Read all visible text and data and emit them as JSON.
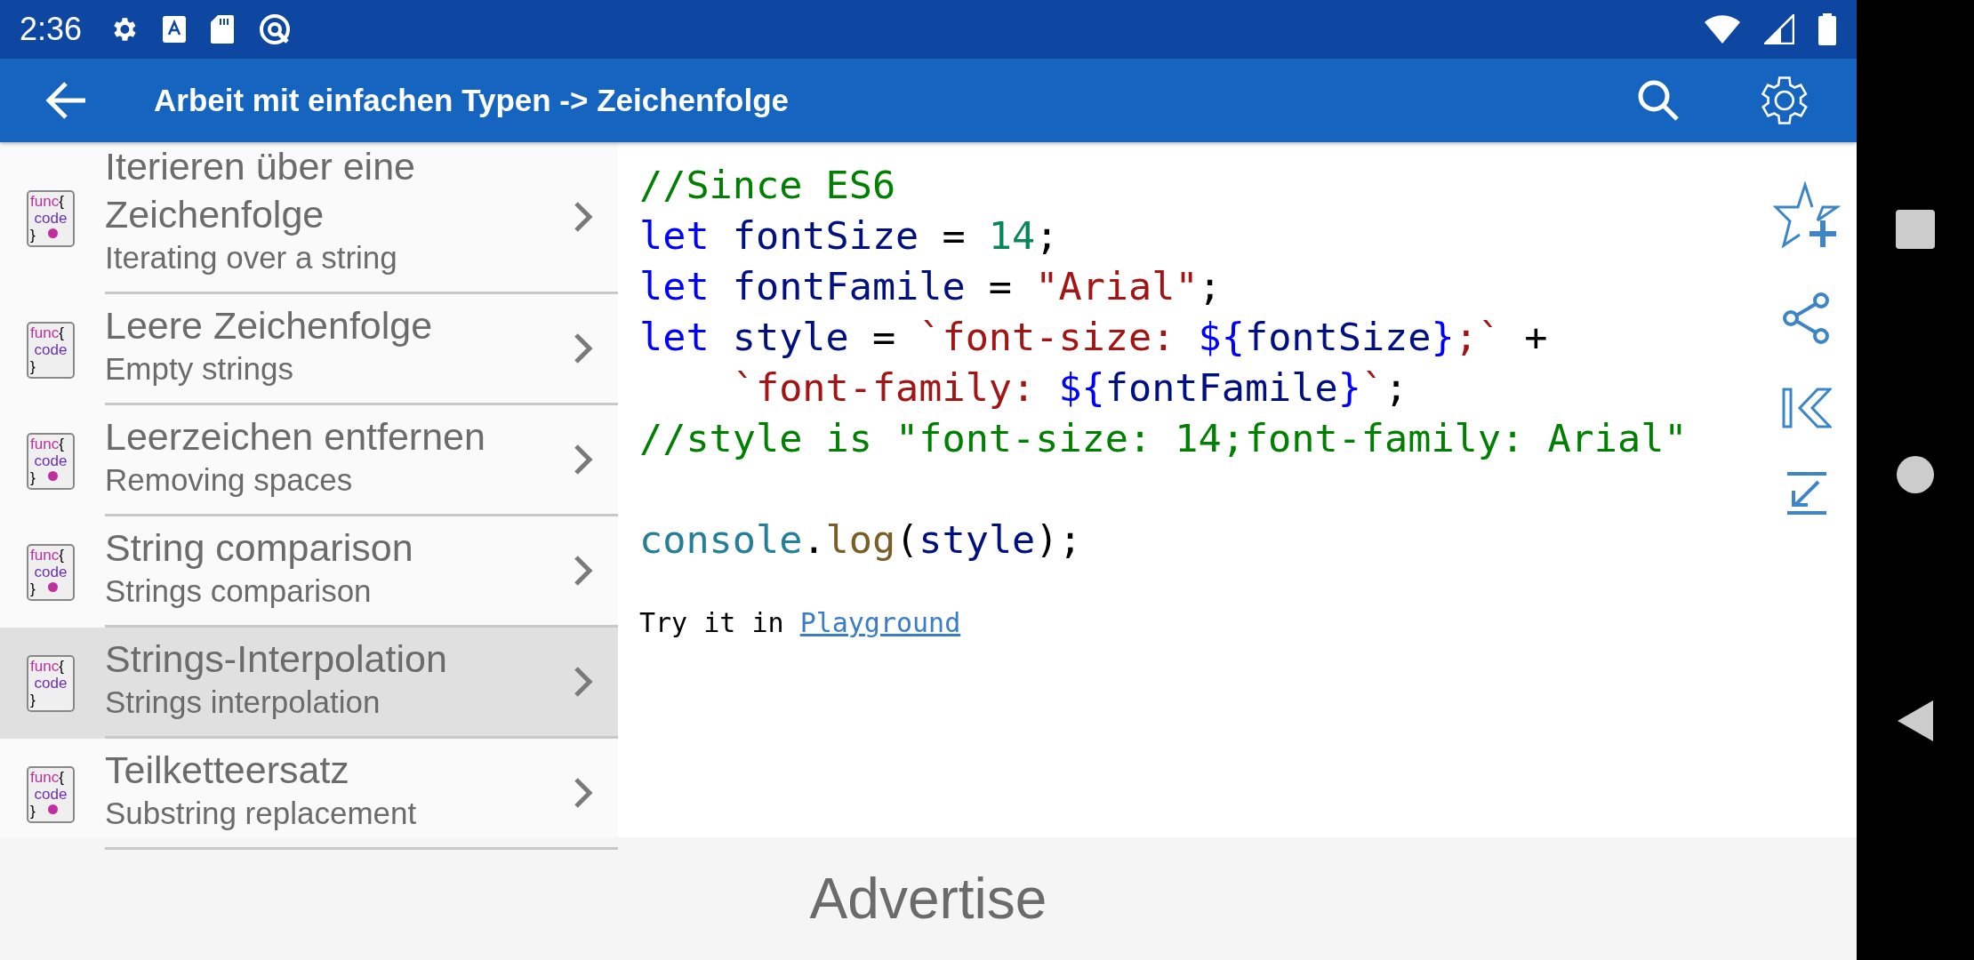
{
  "status_bar": {
    "time": "2:36"
  },
  "app_bar": {
    "title": "Arbeit mit einfachen Typen -> Zeichenfolge"
  },
  "list": [
    {
      "title": "Iterieren über eine Zeichenfolge",
      "subtitle": "Iterating over a string",
      "selected": false,
      "icon": {
        "func": "func",
        "open": "{",
        "code": "code",
        "close": "}",
        "dot": true
      }
    },
    {
      "title": "Leere Zeichenfolge",
      "subtitle": "Empty strings",
      "selected": false,
      "icon": {
        "func": "func",
        "open": "{",
        "code": "code",
        "close": "}",
        "dot": false
      }
    },
    {
      "title": "Leerzeichen entfernen",
      "subtitle": "Removing spaces",
      "selected": false,
      "icon": {
        "func": "func",
        "open": "{",
        "code": "code",
        "close": "}",
        "dot": true
      }
    },
    {
      "title": "String comparison",
      "subtitle": "Strings comparison",
      "selected": false,
      "icon": {
        "func": "func",
        "open": "{",
        "code": "code",
        "close": "}",
        "dot": true
      }
    },
    {
      "title": "Strings-Interpolation",
      "subtitle": "Strings interpolation",
      "selected": true,
      "icon": {
        "func": "func",
        "open": "{",
        "code": "code",
        "close": "}",
        "dot": false
      }
    },
    {
      "title": "Teilketteersatz",
      "subtitle": "Substring replacement",
      "selected": false,
      "icon": {
        "func": "func",
        "open": "{",
        "code": "code",
        "close": "}",
        "dot": true
      }
    }
  ],
  "code_blocks": [
    {
      "lines": [
        [
          {
            "text": "//Since ES6",
            "kind": "comment"
          }
        ],
        [
          {
            "text": "let",
            "kind": "keyword"
          },
          {
            "text": " fontSize",
            "kind": "ident"
          },
          {
            "text": " = ",
            "kind": "punct"
          },
          {
            "text": "14",
            "kind": "number"
          },
          {
            "text": ";",
            "kind": "punct"
          }
        ],
        [
          {
            "text": "let",
            "kind": "keyword"
          },
          {
            "text": " fontFamile",
            "kind": "ident"
          },
          {
            "text": " = ",
            "kind": "punct"
          },
          {
            "text": "\"Arial\"",
            "kind": "string"
          },
          {
            "text": ";",
            "kind": "punct"
          }
        ],
        [
          {
            "text": "let",
            "kind": "keyword"
          },
          {
            "text": " style",
            "kind": "ident"
          },
          {
            "text": " = ",
            "kind": "punct"
          },
          {
            "text": "`font-size: ",
            "kind": "string"
          },
          {
            "text": "${",
            "kind": "interp"
          },
          {
            "text": "fontSize",
            "kind": "ident"
          },
          {
            "text": "}",
            "kind": "interp"
          },
          {
            "text": ";`",
            "kind": "string"
          },
          {
            "text": " +",
            "kind": "punct"
          }
        ],
        [
          {
            "text": "    `font-family: ",
            "kind": "string"
          },
          {
            "text": "${",
            "kind": "interp"
          },
          {
            "text": "fontFamile",
            "kind": "ident"
          },
          {
            "text": "}",
            "kind": "interp"
          },
          {
            "text": "`",
            "kind": "string"
          },
          {
            "text": ";",
            "kind": "punct"
          }
        ],
        [
          {
            "text": "//style is \"font-size: 14;font-family: Arial\"",
            "kind": "comment"
          }
        ]
      ]
    },
    {
      "lines": [
        [
          {
            "text": "console",
            "kind": "object"
          },
          {
            "text": ".",
            "kind": "punct"
          },
          {
            "text": "log",
            "kind": "method"
          },
          {
            "text": "(",
            "kind": "punct"
          },
          {
            "text": "style",
            "kind": "ident"
          },
          {
            "text": ");",
            "kind": "punct"
          }
        ]
      ]
    }
  ],
  "try_it": {
    "text": "Try it in ",
    "link": "Playground"
  },
  "advertise": "Advertise"
}
